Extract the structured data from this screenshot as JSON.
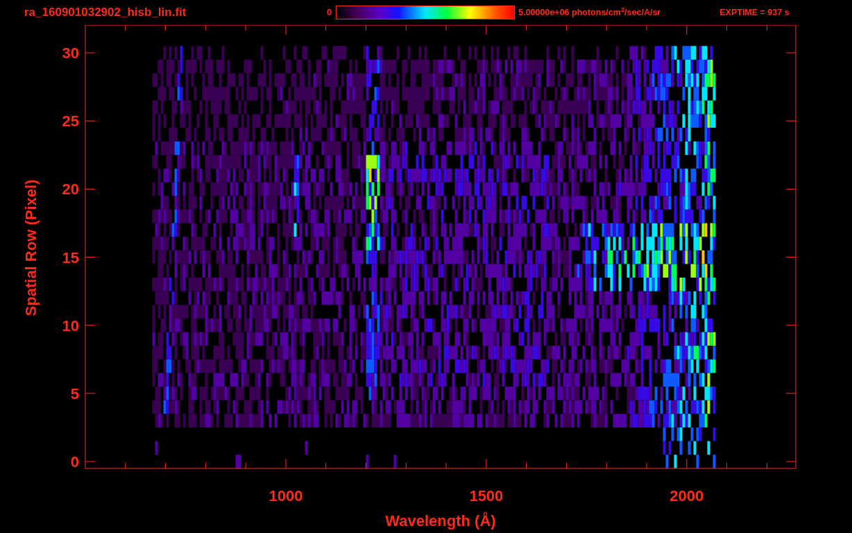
{
  "header": {
    "title": "ra_160901032902_hisb_lin.fit",
    "colorbar": {
      "min_label": "0",
      "max_label": "5.00000e+06 photons/cm$^{2}$/sec/A/sr"
    },
    "exposure": "EXPTIME = 937 s"
  },
  "plot": {
    "xlabel": "Wavelength (Å)",
    "ylabel": "Spatial Row (Pixel)",
    "xticks": [
      "1000",
      "1500",
      "2000"
    ],
    "yticks": [
      "30",
      "25",
      "20",
      "15",
      "10",
      "5",
      "0"
    ]
  }
}
